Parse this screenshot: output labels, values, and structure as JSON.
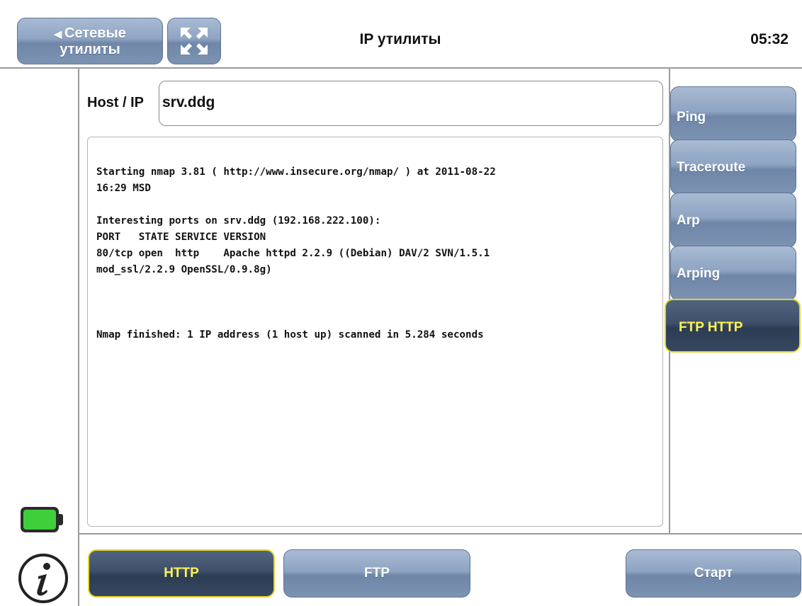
{
  "header": {
    "back_label_line1": "Сетевые",
    "back_label_line2": "утилиты",
    "title": "IP утилиты",
    "clock": "05:32"
  },
  "host": {
    "label": "Host / IP",
    "value": "srv.ddg"
  },
  "output": {
    "lines": [
      "Starting nmap 3.81 ( http://www.insecure.org/nmap/ ) at 2011-08-22",
      "16:29 MSD",
      "",
      "Interesting ports on srv.ddg (192.168.222.100):",
      "PORT   STATE SERVICE VERSION",
      "80/tcp open  http    Apache httpd 2.2.9 ((Debian) DAV/2 SVN/1.5.1",
      "mod_ssl/2.2.9 OpenSSL/0.9.8g)",
      "",
      "",
      "",
      "Nmap finished: 1 IP address (1 host up) scanned in 5.284 seconds"
    ]
  },
  "side_tabs": [
    {
      "label": "Ping",
      "active": false
    },
    {
      "label": "Traceroute",
      "active": false
    },
    {
      "label": "Arp",
      "active": false
    },
    {
      "label": "Arping",
      "active": false
    },
    {
      "label": "FTP HTTP",
      "active": true
    }
  ],
  "bottom": {
    "http_label": "HTTP",
    "ftp_label": "FTP",
    "start_label": "Старт"
  },
  "status": {
    "battery_level": 1.0
  },
  "icons": {
    "back": "back-arrow-icon",
    "zoom": "expand-arrows-icon",
    "battery": "battery-icon",
    "info": "info-icon"
  },
  "colors": {
    "button_blue": "#8ea4c2",
    "button_active": "#3e5069",
    "active_text": "#fff25a",
    "active_border": "#e3d52a",
    "battery_green": "#3fcf3a"
  }
}
